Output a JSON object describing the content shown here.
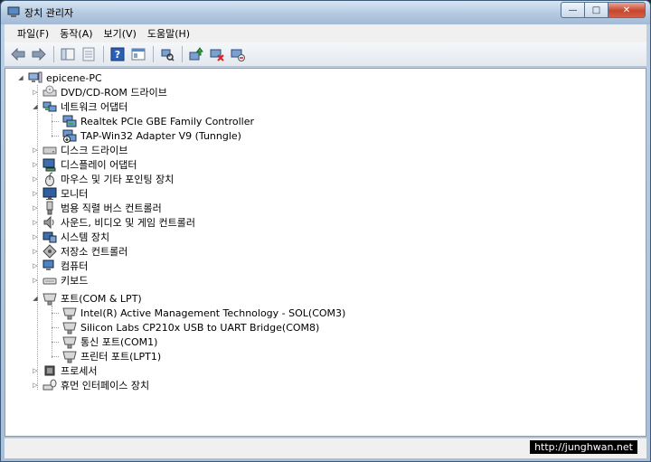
{
  "window": {
    "title": "장치 관리자",
    "min_glyph": "—",
    "max_glyph": "□",
    "close_glyph": "✕"
  },
  "menu": [
    "파일(F)",
    "동작(A)",
    "보기(V)",
    "도움말(H)"
  ],
  "toolbar": [
    "back-icon",
    "forward-icon",
    "up-icon",
    "properties-icon",
    "help-icon",
    "view-icon",
    "scan-icon",
    "update-driver-icon",
    "disable-icon",
    "uninstall-icon"
  ],
  "tree": {
    "root": "epicene-PC",
    "categories": [
      {
        "label": "DVD/CD-ROM 드라이브",
        "icon": "dvd-drive-icon",
        "expanded": false,
        "children": []
      },
      {
        "label": "네트워크 어댑터",
        "icon": "network-adapter-icon",
        "expanded": true,
        "children": [
          {
            "label": "Realtek PCIe GBE Family Controller",
            "icon": "network-card-icon"
          },
          {
            "label": "TAP-Win32 Adapter V9 (Tunngle)",
            "icon": "network-card-warning-icon"
          }
        ]
      },
      {
        "label": "디스크 드라이브",
        "icon": "disk-drive-icon",
        "expanded": false,
        "children": []
      },
      {
        "label": "디스플레이 어댑터",
        "icon": "display-adapter-icon",
        "expanded": false,
        "children": []
      },
      {
        "label": "마우스 및 기타 포인팅 장치",
        "icon": "mouse-icon",
        "expanded": false,
        "children": []
      },
      {
        "label": "모니터",
        "icon": "monitor-icon",
        "expanded": false,
        "children": []
      },
      {
        "label": "범용 직렬 버스 컨트롤러",
        "icon": "usb-icon",
        "expanded": false,
        "children": []
      },
      {
        "label": "사운드, 비디오 및 게임 컨트롤러",
        "icon": "speaker-icon",
        "expanded": false,
        "children": []
      },
      {
        "label": "시스템 장치",
        "icon": "system-device-icon",
        "expanded": false,
        "children": []
      },
      {
        "label": "저장소 컨트롤러",
        "icon": "storage-controller-icon",
        "expanded": false,
        "children": []
      },
      {
        "label": "컴퓨터",
        "icon": "computer-icon",
        "expanded": false,
        "children": []
      },
      {
        "label": "키보드",
        "icon": "keyboard-icon",
        "expanded": false,
        "children": []
      },
      {
        "label": "포트(COM & LPT)",
        "icon": "port-icon",
        "expanded": true,
        "children": [
          {
            "label": "Intel(R) Active Management Technology - SOL(COM3)",
            "icon": "port-device-icon"
          },
          {
            "label": "Silicon Labs CP210x USB to UART Bridge(COM8)",
            "icon": "port-device-icon"
          },
          {
            "label": "통신 포트(COM1)",
            "icon": "port-device-icon"
          },
          {
            "label": "프린터 포트(LPT1)",
            "icon": "port-device-icon"
          }
        ]
      },
      {
        "label": "프로세서",
        "icon": "processor-icon",
        "expanded": false,
        "children": []
      },
      {
        "label": "휴먼 인터페이스 장치",
        "icon": "hid-icon",
        "expanded": false,
        "children": []
      }
    ]
  },
  "watermark": "http://junghwan.net"
}
